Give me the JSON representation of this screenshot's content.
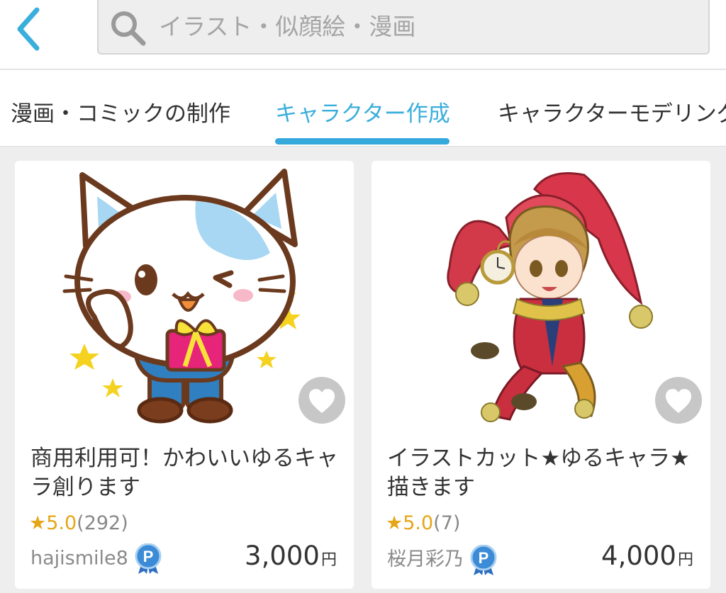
{
  "search": {
    "placeholder": "イラスト・似顔絵・漫画"
  },
  "tabs": [
    {
      "label": "漫画・コミックの制作",
      "active": false
    },
    {
      "label": "キャラクター作成",
      "active": true
    },
    {
      "label": "キャラクターモデリング",
      "active": false
    }
  ],
  "colors": {
    "accent": "#35a9db",
    "star": "#e6a516",
    "background": "#eeeeee"
  },
  "icons": {
    "back": "chevron-left-icon",
    "search": "magnifier-icon",
    "favorite": "heart-icon",
    "badge": "pro-badge-icon"
  },
  "cards": [
    {
      "title": "商用利用可！かわいいゆるキャラ創ります",
      "rating": "★5.0",
      "review_count": "(292)",
      "seller": "hajismile8",
      "price": "3,000",
      "currency": "円"
    },
    {
      "title": "イラストカット★ゆるキャラ★　描きます",
      "rating": "★5.0",
      "review_count": "(7)",
      "seller": "桜月彩乃",
      "price": "4,000",
      "currency": "円"
    }
  ]
}
